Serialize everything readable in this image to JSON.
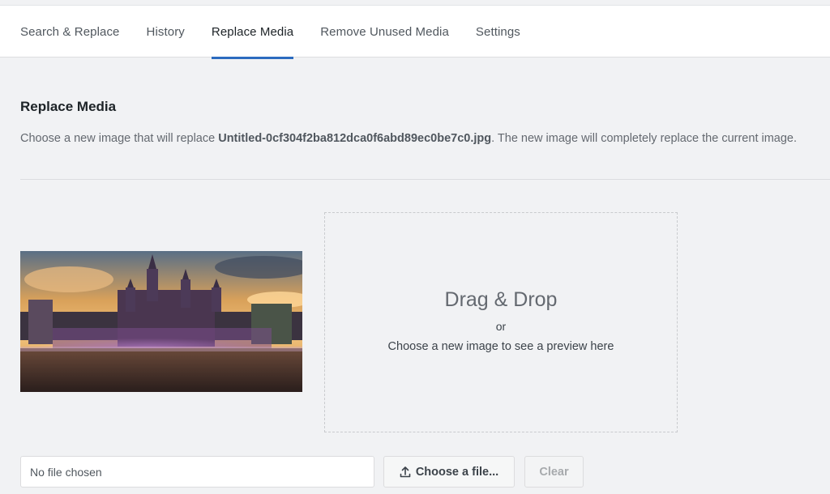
{
  "tabs": [
    {
      "label": "Search & Replace",
      "active": false
    },
    {
      "label": "History",
      "active": false
    },
    {
      "label": "Replace Media",
      "active": true
    },
    {
      "label": "Remove Unused Media",
      "active": false
    },
    {
      "label": "Settings",
      "active": false
    }
  ],
  "section": {
    "title": "Replace Media",
    "description_prefix": "Choose a new image that will replace ",
    "filename": "Untitled-0cf304f2ba812dca0f6abd89ec0be7c0.jpg",
    "description_suffix": ". The new image will completely replace the current image."
  },
  "dropzone": {
    "title": "Drag & Drop",
    "or": "or",
    "hint": "Choose a new image to see a preview here"
  },
  "file": {
    "value": "No file chosen",
    "choose_label": "Choose a file...",
    "choose_icon": "upload-icon",
    "clear_label": "Clear"
  },
  "colors": {
    "accent": "#2c6bbf",
    "background": "#f1f2f4"
  }
}
